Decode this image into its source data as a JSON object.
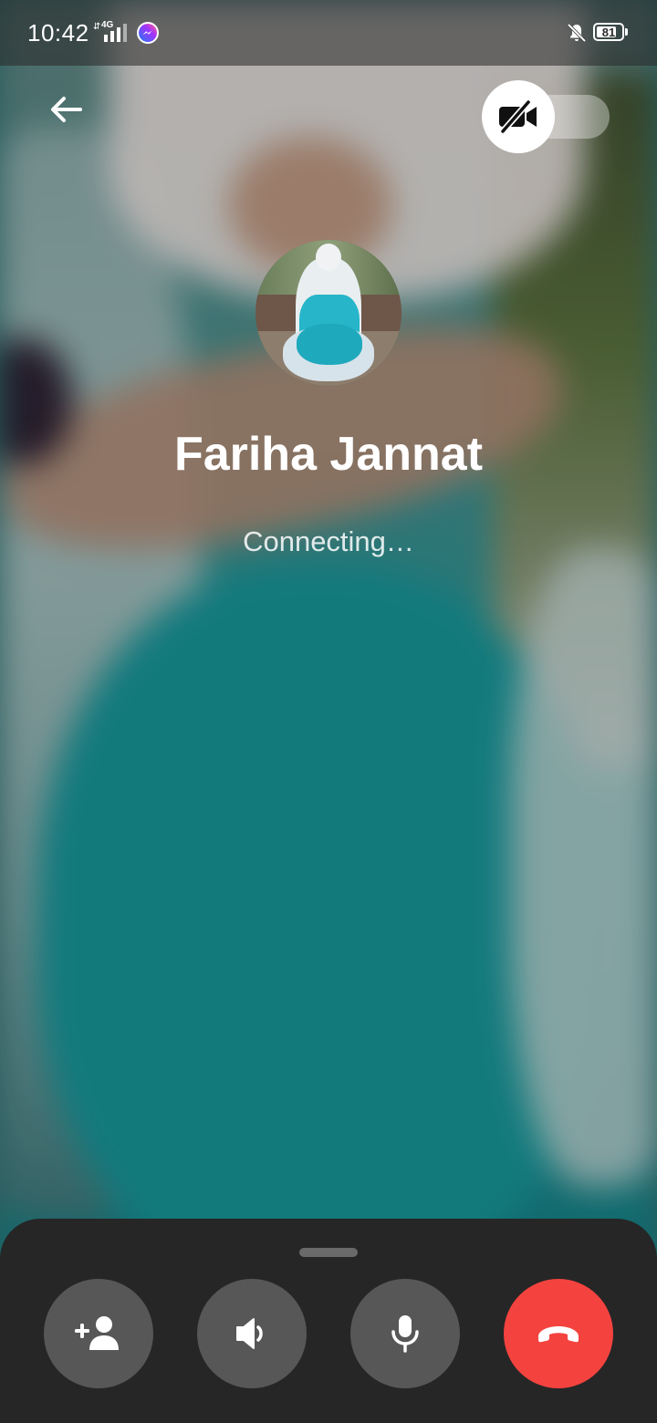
{
  "status_bar": {
    "time": "10:42",
    "network": "4G",
    "battery": "81",
    "notification_app": "messenger-icon",
    "silent_icon": "bell-off-icon"
  },
  "top_bar": {
    "back_icon": "arrow-left-icon",
    "video_toggle_icon": "video-off-icon",
    "video_enabled": false
  },
  "contact": {
    "name": "Fariha Jannat",
    "status": "Connecting…"
  },
  "controls": [
    {
      "icon": "add-person-icon"
    },
    {
      "icon": "speaker-icon"
    },
    {
      "icon": "microphone-icon"
    },
    {
      "icon": "end-call-icon"
    }
  ],
  "colors": {
    "end_call": "#f4433f",
    "control_bg": "#575757",
    "sheet_bg": "#262626"
  }
}
